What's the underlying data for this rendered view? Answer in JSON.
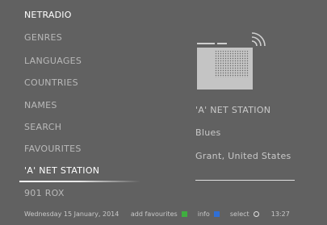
{
  "header": {
    "title": "NETRADIO"
  },
  "menu": {
    "items": [
      {
        "label": "GENRES"
      },
      {
        "label": "LANGUAGES"
      },
      {
        "label": "COUNTRIES"
      },
      {
        "label": "NAMES"
      },
      {
        "label": "SEARCH"
      },
      {
        "label": "FAVOURITES"
      },
      {
        "label": "'A' NET STATION"
      },
      {
        "label": "901 ROX"
      }
    ],
    "selected_index": 6
  },
  "station": {
    "icon": "radio-icon",
    "name": "'A' NET STATION",
    "genre": "Blues",
    "location": "Grant, United States"
  },
  "footer": {
    "date": "Wednesday 15 January, 2014",
    "add_favourites_label": "add favourites",
    "info_label": "info",
    "select_label": "select",
    "time": "13:27"
  },
  "colors": {
    "background": "#616161",
    "green_key": "#3fae3f",
    "blue_key": "#2f6fd6"
  }
}
